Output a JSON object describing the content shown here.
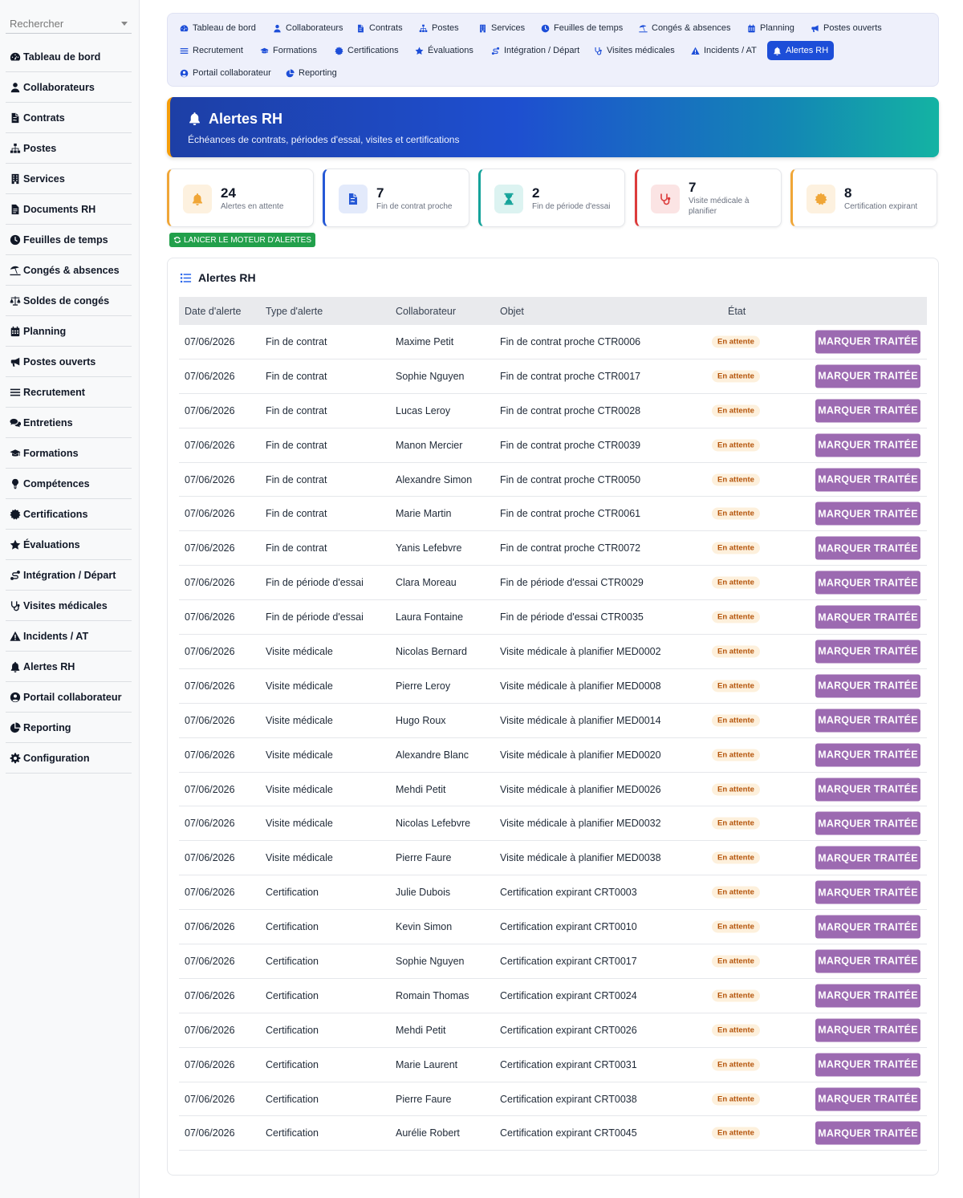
{
  "search": {
    "placeholder": "Rechercher"
  },
  "sidebar": {
    "items": [
      {
        "label": "Tableau de bord",
        "icon": "gauge-icon"
      },
      {
        "label": "Collaborateurs",
        "icon": "user-icon"
      },
      {
        "label": "Contrats",
        "icon": "file-contract-icon"
      },
      {
        "label": "Postes",
        "icon": "sitemap-icon"
      },
      {
        "label": "Services",
        "icon": "building-icon"
      },
      {
        "label": "Documents RH",
        "icon": "file-icon"
      },
      {
        "label": "Feuilles de temps",
        "icon": "clock-icon"
      },
      {
        "label": "Congés & absences",
        "icon": "umbrella-beach-icon"
      },
      {
        "label": "Soldes de congés",
        "icon": "scale-icon"
      },
      {
        "label": "Planning",
        "icon": "calendar-icon"
      },
      {
        "label": "Postes ouverts",
        "icon": "bullhorn-icon"
      },
      {
        "label": "Recrutement",
        "icon": "bars-icon"
      },
      {
        "label": "Entretiens",
        "icon": "comments-icon"
      },
      {
        "label": "Formations",
        "icon": "graduation-cap-icon"
      },
      {
        "label": "Compétences",
        "icon": "lightbulb-icon"
      },
      {
        "label": "Certifications",
        "icon": "certificate-icon"
      },
      {
        "label": "Évaluations",
        "icon": "star-icon"
      },
      {
        "label": "Intégration / Départ",
        "icon": "route-icon"
      },
      {
        "label": "Visites médicales",
        "icon": "stethoscope-icon"
      },
      {
        "label": "Incidents / AT",
        "icon": "warning-icon"
      },
      {
        "label": "Alertes RH",
        "icon": "bell-icon"
      },
      {
        "label": "Portail collaborateur",
        "icon": "user-circle-icon"
      },
      {
        "label": "Reporting",
        "icon": "chart-pie-icon"
      },
      {
        "label": "Configuration",
        "icon": "gear-icon"
      }
    ]
  },
  "topnav": {
    "items": [
      {
        "label": "Tableau de bord",
        "icon": "gauge-icon"
      },
      {
        "label": "Collaborateurs",
        "icon": "user-icon"
      },
      {
        "label": "Contrats",
        "icon": "file-contract-icon"
      },
      {
        "label": "Postes",
        "icon": "sitemap-icon"
      },
      {
        "label": "Services",
        "icon": "building-icon"
      },
      {
        "label": "Feuilles de temps",
        "icon": "clock-icon"
      },
      {
        "label": "Congés & absences",
        "icon": "umbrella-beach-icon"
      },
      {
        "label": "Planning",
        "icon": "calendar-icon"
      },
      {
        "label": "Postes ouverts",
        "icon": "bullhorn-icon"
      },
      {
        "label": "Recrutement",
        "icon": "bars-icon"
      },
      {
        "label": "Formations",
        "icon": "graduation-cap-icon"
      },
      {
        "label": "Certifications",
        "icon": "certificate-icon"
      },
      {
        "label": "Évaluations",
        "icon": "star-icon"
      },
      {
        "label": "Intégration / Départ",
        "icon": "route-icon"
      },
      {
        "label": "Visites médicales",
        "icon": "stethoscope-icon"
      },
      {
        "label": "Incidents / AT",
        "icon": "warning-icon"
      },
      {
        "label": "Alertes RH",
        "icon": "bell-icon",
        "active": true
      },
      {
        "label": "Portail collaborateur",
        "icon": "user-circle-icon"
      },
      {
        "label": "Reporting",
        "icon": "chart-pie-icon"
      }
    ]
  },
  "banner": {
    "title": "Alertes RH",
    "subtitle": "Échéances de contrats, périodes d'essai, visites et certifications",
    "icon": "bell-icon"
  },
  "stats": [
    {
      "value": "24",
      "label": "Alertes en attente",
      "icon": "bell-icon",
      "color": "#f0a637",
      "bg": "#fdf1df"
    },
    {
      "value": "7",
      "label": "Fin de contrat proche",
      "icon": "file-contract-icon",
      "color": "#2558d6",
      "bg": "#e3eafb"
    },
    {
      "value": "2",
      "label": "Fin de période d'essai",
      "icon": "hourglass-icon",
      "color": "#14a39a",
      "bg": "#dcf3f1"
    },
    {
      "value": "7",
      "label": "Visite médicale à planifier",
      "icon": "stethoscope-icon",
      "color": "#dc3b3b",
      "bg": "#fbe4e4"
    },
    {
      "value": "8",
      "label": "Certification expirant",
      "icon": "certificate-icon",
      "color": "#f0a637",
      "bg": "#fdf1df"
    }
  ],
  "engine_button": {
    "label": "LANCER LE MOTEUR D'ALERTES",
    "icon": "sync-icon"
  },
  "table": {
    "title": "Alertes RH",
    "icon": "list-icon",
    "headers": {
      "date": "Date d'alerte",
      "type": "Type d'alerte",
      "employee": "Collaborateur",
      "object": "Objet",
      "state": "État"
    },
    "action_label": "MARQUER TRAITÉE",
    "rows": [
      {
        "date": "07/06/2026",
        "type": "Fin de contrat",
        "employee": "Maxime Petit",
        "object": "Fin de contrat proche CTR0006",
        "state": "En attente"
      },
      {
        "date": "07/06/2026",
        "type": "Fin de contrat",
        "employee": "Sophie Nguyen",
        "object": "Fin de contrat proche CTR0017",
        "state": "En attente"
      },
      {
        "date": "07/06/2026",
        "type": "Fin de contrat",
        "employee": "Lucas Leroy",
        "object": "Fin de contrat proche CTR0028",
        "state": "En attente"
      },
      {
        "date": "07/06/2026",
        "type": "Fin de contrat",
        "employee": "Manon Mercier",
        "object": "Fin de contrat proche CTR0039",
        "state": "En attente"
      },
      {
        "date": "07/06/2026",
        "type": "Fin de contrat",
        "employee": "Alexandre Simon",
        "object": "Fin de contrat proche CTR0050",
        "state": "En attente"
      },
      {
        "date": "07/06/2026",
        "type": "Fin de contrat",
        "employee": "Marie Martin",
        "object": "Fin de contrat proche CTR0061",
        "state": "En attente"
      },
      {
        "date": "07/06/2026",
        "type": "Fin de contrat",
        "employee": "Yanis Lefebvre",
        "object": "Fin de contrat proche CTR0072",
        "state": "En attente"
      },
      {
        "date": "07/06/2026",
        "type": "Fin de période d'essai",
        "employee": "Clara Moreau",
        "object": "Fin de période d'essai CTR0029",
        "state": "En attente"
      },
      {
        "date": "07/06/2026",
        "type": "Fin de période d'essai",
        "employee": "Laura Fontaine",
        "object": "Fin de période d'essai CTR0035",
        "state": "En attente"
      },
      {
        "date": "07/06/2026",
        "type": "Visite médicale",
        "employee": "Nicolas Bernard",
        "object": "Visite médicale à planifier MED0002",
        "state": "En attente"
      },
      {
        "date": "07/06/2026",
        "type": "Visite médicale",
        "employee": "Pierre Leroy",
        "object": "Visite médicale à planifier MED0008",
        "state": "En attente"
      },
      {
        "date": "07/06/2026",
        "type": "Visite médicale",
        "employee": "Hugo Roux",
        "object": "Visite médicale à planifier MED0014",
        "state": "En attente"
      },
      {
        "date": "07/06/2026",
        "type": "Visite médicale",
        "employee": "Alexandre Blanc",
        "object": "Visite médicale à planifier MED0020",
        "state": "En attente"
      },
      {
        "date": "07/06/2026",
        "type": "Visite médicale",
        "employee": "Mehdi Petit",
        "object": "Visite médicale à planifier MED0026",
        "state": "En attente"
      },
      {
        "date": "07/06/2026",
        "type": "Visite médicale",
        "employee": "Nicolas Lefebvre",
        "object": "Visite médicale à planifier MED0032",
        "state": "En attente"
      },
      {
        "date": "07/06/2026",
        "type": "Visite médicale",
        "employee": "Pierre Faure",
        "object": "Visite médicale à planifier MED0038",
        "state": "En attente"
      },
      {
        "date": "07/06/2026",
        "type": "Certification",
        "employee": "Julie Dubois",
        "object": "Certification expirant CRT0003",
        "state": "En attente"
      },
      {
        "date": "07/06/2026",
        "type": "Certification",
        "employee": "Kevin Simon",
        "object": "Certification expirant CRT0010",
        "state": "En attente"
      },
      {
        "date": "07/06/2026",
        "type": "Certification",
        "employee": "Sophie Nguyen",
        "object": "Certification expirant CRT0017",
        "state": "En attente"
      },
      {
        "date": "07/06/2026",
        "type": "Certification",
        "employee": "Romain Thomas",
        "object": "Certification expirant CRT0024",
        "state": "En attente"
      },
      {
        "date": "07/06/2026",
        "type": "Certification",
        "employee": "Mehdi Petit",
        "object": "Certification expirant CRT0026",
        "state": "En attente"
      },
      {
        "date": "07/06/2026",
        "type": "Certification",
        "employee": "Marie Laurent",
        "object": "Certification expirant CRT0031",
        "state": "En attente"
      },
      {
        "date": "07/06/2026",
        "type": "Certification",
        "employee": "Pierre Faure",
        "object": "Certification expirant CRT0038",
        "state": "En attente"
      },
      {
        "date": "07/06/2026",
        "type": "Certification",
        "employee": "Aurélie Robert",
        "object": "Certification expirant CRT0045",
        "state": "En attente"
      }
    ]
  },
  "colors": {
    "accent": "#1d4ed8",
    "action": "#9c6ab1",
    "success": "#22a04b",
    "badge_bg": "#fdf0dc",
    "badge_text": "#b45309"
  }
}
